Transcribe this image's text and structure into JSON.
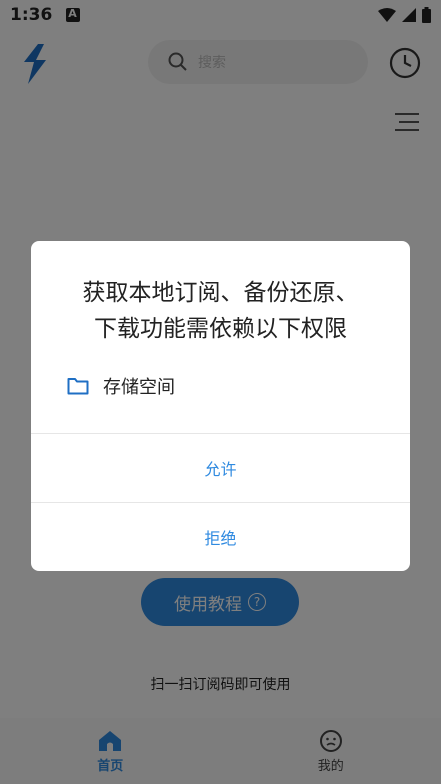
{
  "status_bar": {
    "time": "1:36"
  },
  "search": {
    "placeholder": "搜索"
  },
  "main": {
    "tutorial_button": "使用教程",
    "scan_hint": "扫一扫订阅码即可使用"
  },
  "bottom_nav": [
    {
      "label": "首页",
      "icon": "home-icon",
      "active": true
    },
    {
      "label": "我的",
      "icon": "profile-face-icon",
      "active": false
    }
  ],
  "dialog": {
    "title_line1": "获取本地订阅、备份还原、",
    "title_line2": "下载功能需依赖以下权限",
    "permission_label": "存储空间",
    "permission_icon": "folder-icon",
    "allow_label": "允许",
    "deny_label": "拒绝"
  },
  "colors": {
    "accent": "#2f8ae0",
    "scrim": "rgba(0,0,0,0.5)"
  }
}
